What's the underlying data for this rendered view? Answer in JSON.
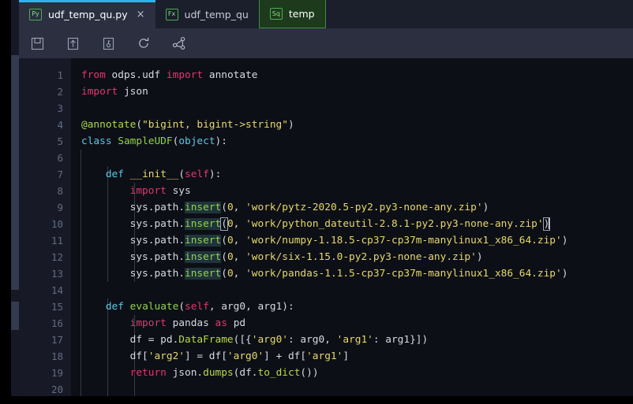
{
  "tabs": [
    {
      "icon": "Py",
      "icon_name": "python-file-icon",
      "label": "udf_temp_qu.py",
      "close": "×",
      "state": "active"
    },
    {
      "icon": "Fx",
      "icon_name": "function-file-icon",
      "label": "udf_temp_qu",
      "close": "",
      "state": "inactive"
    },
    {
      "icon": "Sq",
      "icon_name": "sql-file-icon",
      "label": "temp",
      "close": "",
      "state": "highlighted"
    }
  ],
  "toolbar": {
    "buttons": [
      {
        "name": "save-button",
        "title": "Save"
      },
      {
        "name": "submit-button",
        "title": "Submit"
      },
      {
        "name": "publish-button",
        "title": "Publish"
      },
      {
        "name": "refresh-button",
        "title": "Refresh"
      },
      {
        "name": "lineage-button",
        "title": "Lineage"
      }
    ]
  },
  "editor": {
    "line_numbers": [
      "1",
      "2",
      "3",
      "4",
      "5",
      "6",
      "7",
      "8",
      "9",
      "10",
      "11",
      "12",
      "13",
      "14",
      "15",
      "16",
      "17",
      "18",
      "19",
      "20"
    ],
    "lines": [
      "from odps.udf import annotate",
      "import json",
      "",
      "@annotate(\"bigint, bigint->string\")",
      "class SampleUDF(object):",
      "",
      "    def __init__(self):",
      "        import sys",
      "        sys.path.insert(0, 'work/pytz-2020.5-py2.py3-none-any.zip')",
      "        sys.path.insert(0, 'work/python_dateutil-2.8.1-py2.py3-none-any.zip')",
      "        sys.path.insert(0, 'work/numpy-1.18.5-cp37-cp37m-manylinux1_x86_64.zip')",
      "        sys.path.insert(0, 'work/six-1.15.0-py2.py3-none-any.zip')",
      "        sys.path.insert(0, 'work/pandas-1.1.5-cp37-cp37m-manylinux1_x86_64.zip')",
      "",
      "    def evaluate(self, arg0, arg1):",
      "        import pandas as pd",
      "        df = pd.DataFrame([{'arg0': arg0, 'arg1': arg1}])",
      "        df['arg2'] = df['arg0'] + df['arg1']",
      "        return json.dumps(df.to_dict())",
      ""
    ],
    "cursor_line": 10,
    "language": "python"
  },
  "colors": {
    "editor_background": "#0d0f16",
    "gutter_background": "#171a26",
    "tabbar_background": "#1b1e2b",
    "toolbar_background": "#2b2f40",
    "active_tab_accent": "#29b6e8",
    "keyword": "#e0386e",
    "keyword_alt": "#5bc8e8",
    "string": "#e6d96a",
    "function": "#8fd44a",
    "decorator": "#a8d94a",
    "text": "#d6dae4",
    "line_number": "#636b82",
    "sql_tab_background": "#1d3a1c",
    "sql_tab_border": "#3f8f3c"
  }
}
